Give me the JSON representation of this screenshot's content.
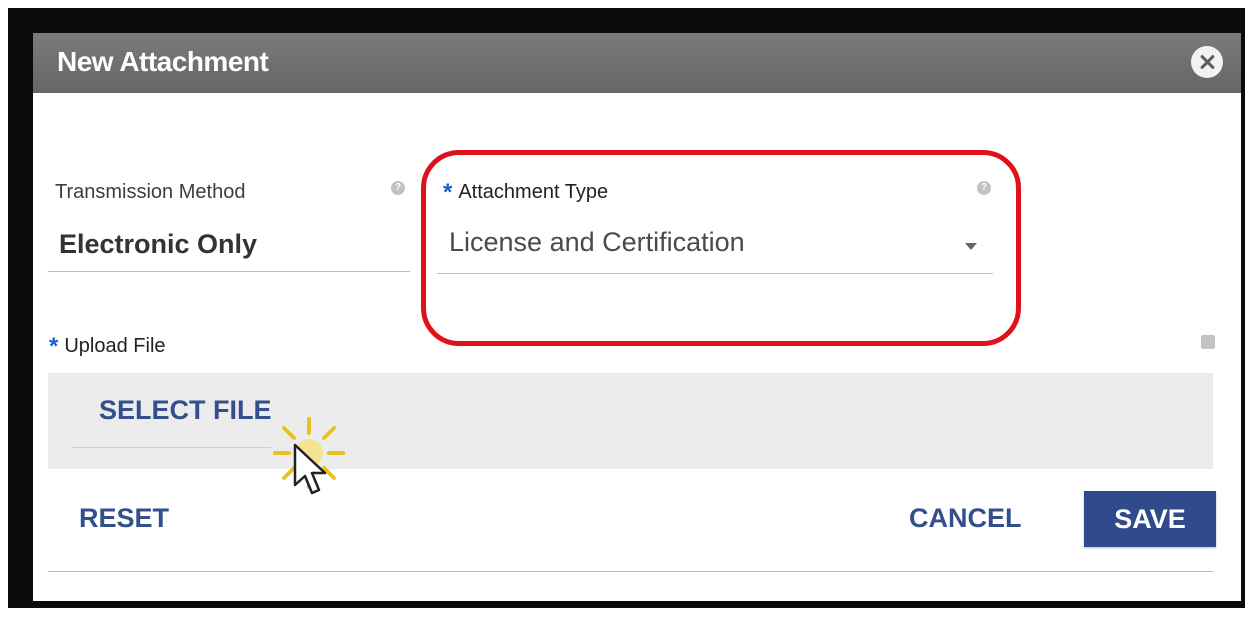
{
  "dialog": {
    "title": "New Attachment",
    "close_icon": "close-circle-icon"
  },
  "transmission_method": {
    "label": "Transmission Method",
    "value": "Electronic Only"
  },
  "attachment_type": {
    "required_marker": "*",
    "label": "Attachment Type",
    "value": "License and Certification"
  },
  "upload_file": {
    "required_marker": "*",
    "label": "Upload File",
    "select_button": "SELECT FILE"
  },
  "actions": {
    "reset": "RESET",
    "cancel": "CANCEL",
    "save": "SAVE"
  },
  "colors": {
    "header": "#6e6e6e",
    "accent": "#2f4b8c",
    "required": "#1a5fd0",
    "highlight": "#e0111a"
  }
}
